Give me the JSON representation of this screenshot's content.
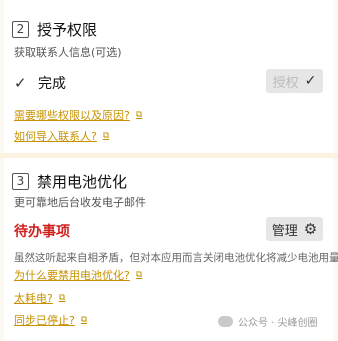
{
  "section1": {
    "number": "2",
    "title": "授予权限",
    "subtitle": "获取联系人信息(可选)",
    "status_label": "完成",
    "authorize_label": "授权",
    "links": [
      {
        "label": "需要哪些权限以及原因?"
      },
      {
        "label": "如何导入联系人?"
      }
    ]
  },
  "section2": {
    "number": "3",
    "title": "禁用电池优化",
    "subtitle": "更可靠地后台收发电子邮件",
    "todo_label": "待办事项",
    "manage_label": "管理",
    "description": "虽然这听起来自相矛盾，但对本应用而言关闭电池优化将减少电池用量",
    "links": [
      {
        "label": "为什么要禁用电池优化?"
      },
      {
        "label": "太耗电?"
      },
      {
        "label": "同步已停止?"
      }
    ]
  },
  "watermark": "公众号 · 尖峰创圈",
  "icons": {
    "check": "check-icon",
    "external": "external-link-icon",
    "gear": "gear-icon"
  },
  "colors": {
    "link": "#c79100",
    "todo": "#d12020",
    "button_bg": "#e6e6e6"
  }
}
